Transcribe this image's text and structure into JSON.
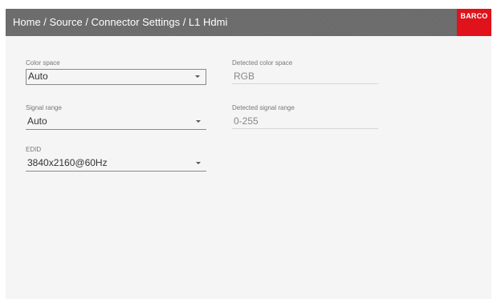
{
  "header": {
    "breadcrumb": "Home / Source / Connector Settings / L1 Hdmi",
    "logo": "BARCO",
    "logo_color": "#e0121b",
    "background_color": "#6b6b6b"
  },
  "fields": {
    "color_space": {
      "label": "Color space",
      "value": "Auto",
      "icon": "chevron-down-icon"
    },
    "signal_range": {
      "label": "Signal range",
      "value": "Auto",
      "icon": "chevron-down-icon"
    },
    "edid": {
      "label": "EDID",
      "value": "3840x2160@60Hz",
      "icon": "chevron-down-icon"
    },
    "detected_color_space": {
      "label": "Detected color space",
      "value": "RGB"
    },
    "detected_signal_range": {
      "label": "Detected signal range",
      "value": "0-255"
    }
  }
}
